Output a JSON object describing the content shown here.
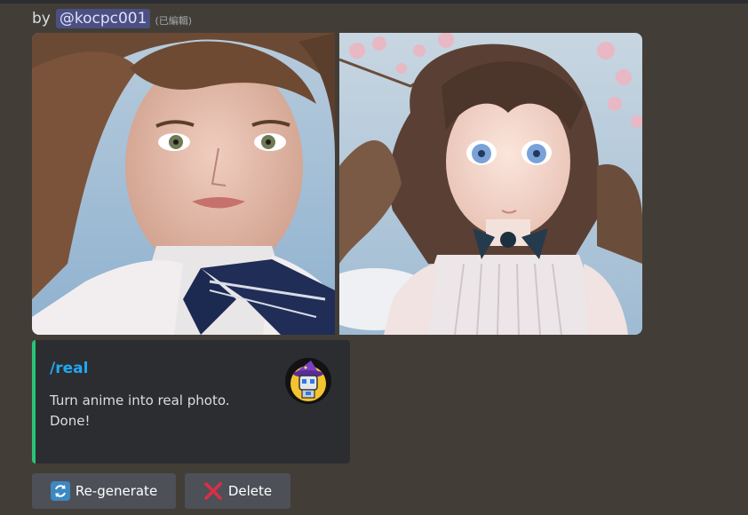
{
  "byline": {
    "prefix": "by",
    "mention": "@kocpc001",
    "edited": "(已編輯)"
  },
  "images": [
    {
      "name": "real-photo-girl",
      "description_icon": "photo-icon"
    },
    {
      "name": "anime-girl",
      "description_icon": "photo-icon"
    }
  ],
  "embed": {
    "title": "/real",
    "description_lines": [
      "Turn anime into real photo.",
      "Done!"
    ],
    "accent_color": "#2bc27a",
    "title_color": "#22a7f0",
    "thumbnail_icon": "robot-wizard-avatar-icon"
  },
  "buttons": {
    "regenerate": {
      "label": "Re-generate",
      "icon": "arrows-counterclockwise-icon"
    },
    "delete": {
      "label": "Delete",
      "icon": "cross-mark-icon"
    }
  }
}
